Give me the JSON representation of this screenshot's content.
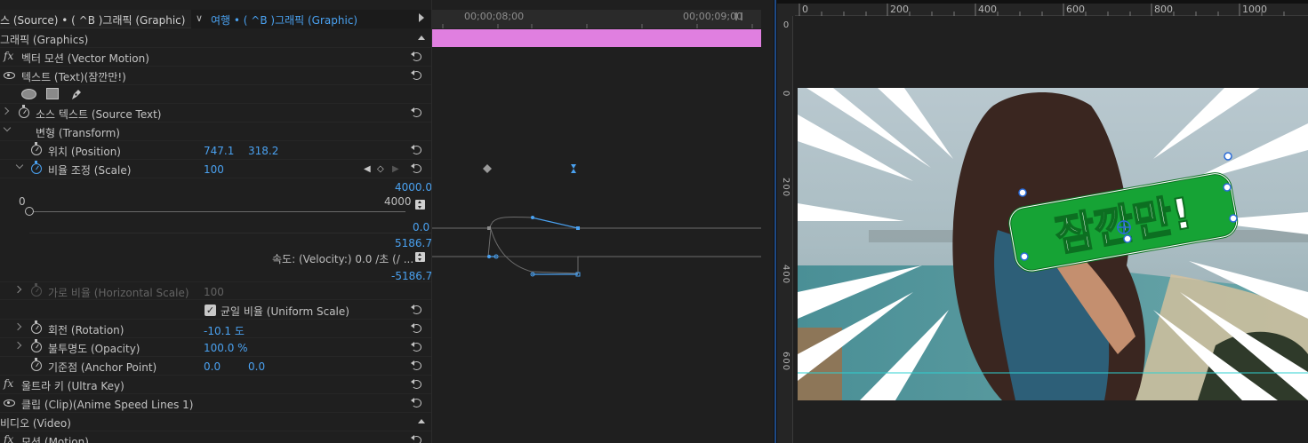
{
  "header": {
    "source_label": "스 (Source) • ( ^B )그래픽 (Graphic)",
    "sequence_tab": "여행 • ( ^B )그래픽 (Graphic)"
  },
  "rows": {
    "graphics": "그래픽 (Graphics)",
    "vector_motion": "벡터 모션 (Vector Motion)",
    "text_layer": "텍스트 (Text)(잠깐만!)",
    "source_text": "소스 텍스트 (Source Text)",
    "transform": "변형 (Transform)",
    "position": {
      "label": "위치 (Position)",
      "x": "747.1",
      "y": "318.2"
    },
    "scale": {
      "label": "비율 조정 (Scale)",
      "value": "100"
    },
    "horizontal_scale": {
      "label": "가로 비율 (Horizontal Scale)",
      "value": "100"
    },
    "uniform_scale": "균일 비율 (Uniform Scale)",
    "rotation": {
      "label": "회전 (Rotation)",
      "value": "-10.1 도"
    },
    "opacity": {
      "label": "불투명도 (Opacity)",
      "value": "100.0 %"
    },
    "anchor": {
      "label": "기준점 (Anchor Point)",
      "x": "0.0",
      "y": "0.0"
    },
    "ultra_key": "울트라 키 (Ultra Key)",
    "clip": "클립 (Clip)(Anime Speed Lines 1)",
    "video": "비디오 (Video)",
    "motion": "모션 (Motion)"
  },
  "scale_graph": {
    "max_top": "4000.0",
    "slider_min": "0",
    "slider_max": "4000",
    "min_value": "0.0",
    "vel_max": "5186.7",
    "velocity_label": "속도: (Velocity:) 0.0 /초 (/ ...",
    "vel_min": "-5186.7"
  },
  "timeline": {
    "t1": "00;00;08;00",
    "t2": "00;00;09;00",
    "clip_color": "#e07fe0",
    "graph_line": "#4aa1f0"
  },
  "monitor": {
    "ruler_h": [
      "0",
      "200",
      "400",
      "600",
      "800",
      "1000"
    ],
    "ruler_v": [
      "0",
      "200",
      "400",
      "600"
    ],
    "ruler_v_top": "0",
    "title_text": "잠깐만!",
    "badge_color": "#16a335"
  },
  "icons": [
    "fx-icon",
    "eye-icon",
    "ellipse-mask-icon",
    "rect-mask-icon",
    "pen-mask-icon",
    "stopwatch-icon",
    "reset-icon",
    "keyframe-prev-icon",
    "keyframe-add-icon",
    "keyframe-next-icon"
  ]
}
